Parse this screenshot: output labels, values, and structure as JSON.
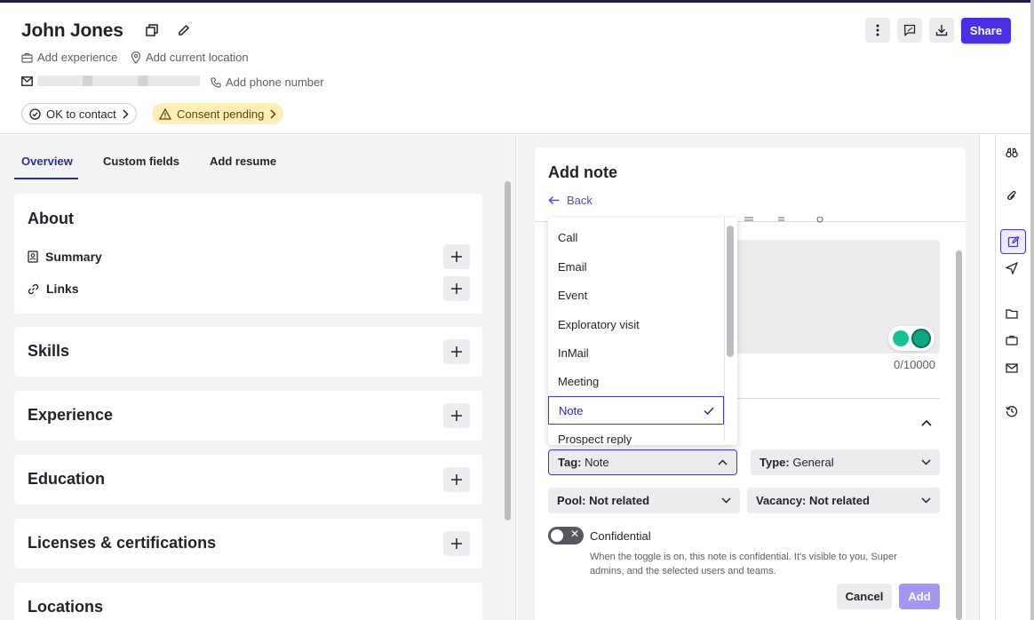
{
  "header": {
    "name": "John Jones",
    "add_experience": "Add experience",
    "add_location": "Add current location",
    "add_phone": "Add phone number",
    "ok_to_contact": "OK to contact",
    "consent_pending": "Consent pending",
    "share_label": "Share"
  },
  "tabs": [
    {
      "label": "Overview",
      "active": true
    },
    {
      "label": "Custom fields",
      "active": false
    },
    {
      "label": "Add resume",
      "active": false
    }
  ],
  "about": {
    "title": "About",
    "summary": "Summary",
    "links": "Links"
  },
  "sections": {
    "skills": "Skills",
    "experience": "Experience",
    "education": "Education",
    "licenses": "Licenses & certifications",
    "locations": "Locations"
  },
  "note": {
    "title": "Add note",
    "back": "Back",
    "counter": "0/10000",
    "tag_label": "Tag:",
    "tag_value": "Note",
    "type_label": "Type:",
    "type_value": "General",
    "pool_label": "Pool:",
    "pool_value": "Not related",
    "vacancy_label": "Vacancy:",
    "vacancy_value": "Not related",
    "confidential_label": "Confidential",
    "confidential_help": "When the toggle is on, this note is confidential. It's visible to you, Super admins, and the selected users and teams.",
    "cancel": "Cancel",
    "add": "Add"
  },
  "dropdown": {
    "options": [
      "Call",
      "Email",
      "Event",
      "Exploratory visit",
      "InMail",
      "Meeting",
      "Note",
      "Prospect reply"
    ],
    "selected": "Note"
  },
  "colors": {
    "accent": "#4a2fe6",
    "warning_bg": "#fcefb8",
    "panel_bg": "#f3f3f4"
  }
}
